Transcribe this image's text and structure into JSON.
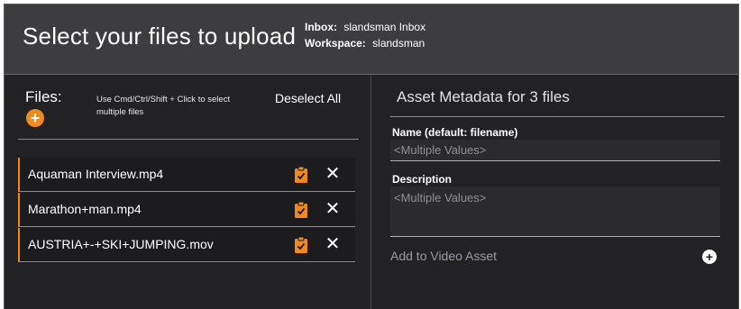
{
  "header": {
    "title": "Select your files to upload",
    "inbox_key": "Inbox:",
    "inbox_value": "slandsman Inbox",
    "workspace_key": "Workspace:",
    "workspace_value": "slandsman"
  },
  "files_panel": {
    "label": "Files:",
    "add_symbol": "+",
    "hint": "Use Cmd/Ctrl/Shift + Click to select multiple files",
    "deselect_label": "Deselect All",
    "files": [
      {
        "name": "Aquaman Interview.mp4"
      },
      {
        "name": "Marathon+man.mp4"
      },
      {
        "name": "AUSTRIA+-+SKI+JUMPING.mov"
      }
    ],
    "remove_symbol": "✕",
    "accent_color": "#f08a1e"
  },
  "metadata_panel": {
    "title": "Asset Metadata for 3 files",
    "name_label": "Name (default: filename)",
    "name_placeholder": "<Multiple Values>",
    "description_label": "Description",
    "description_placeholder": "<Multiple Values>",
    "add_video_label": "Add to Video Asset",
    "add_video_symbol": "+"
  }
}
